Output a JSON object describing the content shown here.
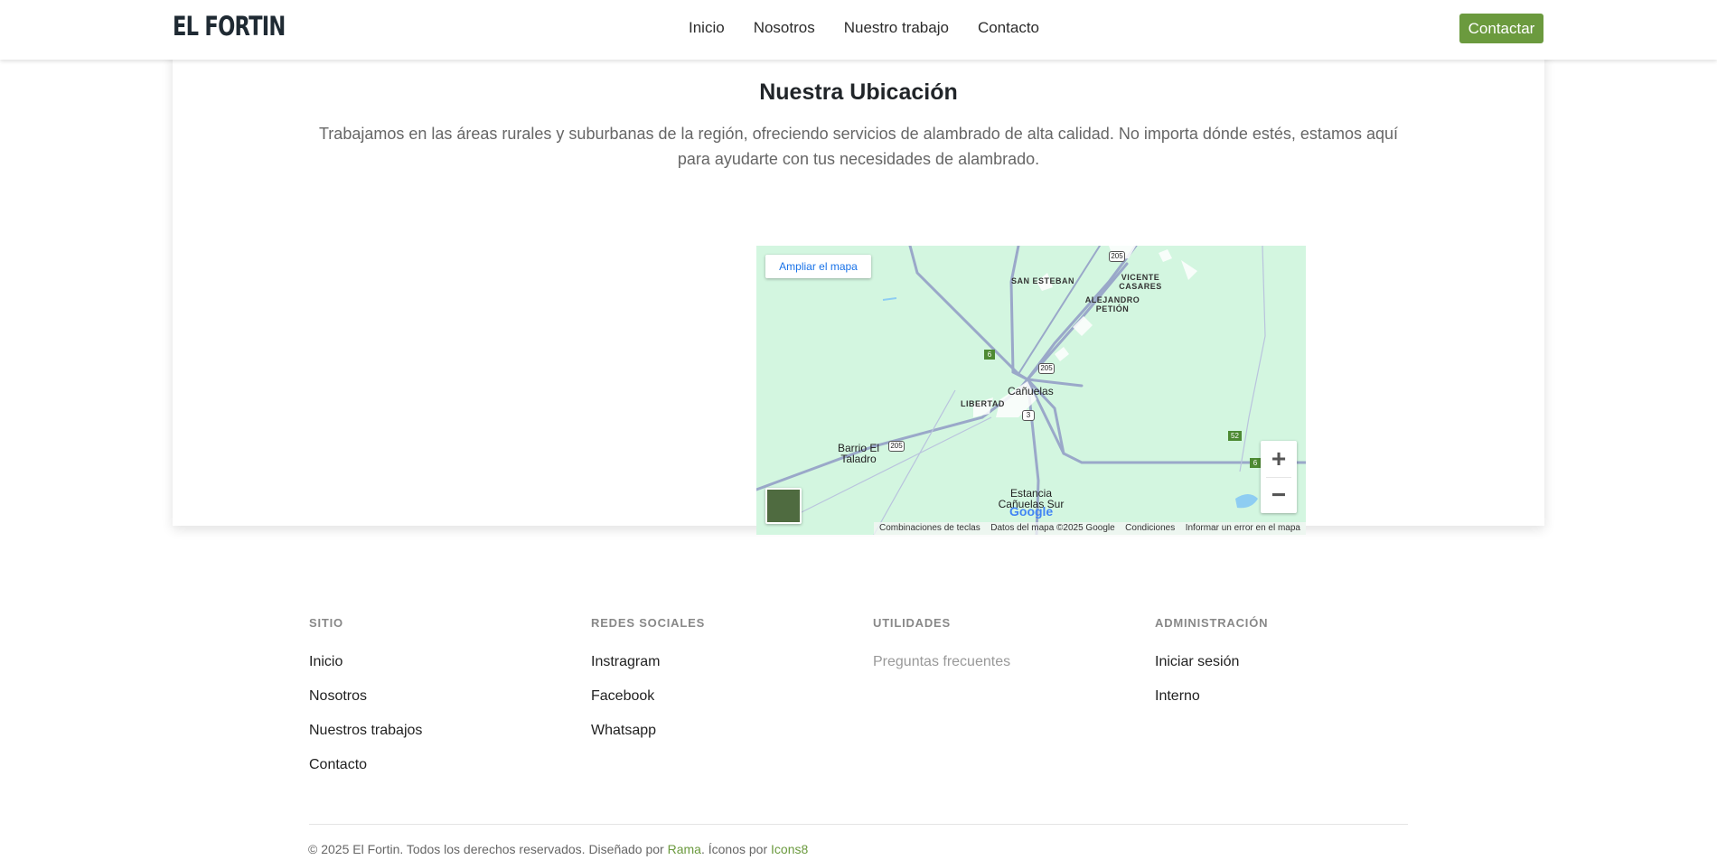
{
  "header": {
    "brand": "EL FORTIN",
    "nav": [
      "Inicio",
      "Nosotros",
      "Nuestro trabajo",
      "Contacto"
    ],
    "cta": "Contactar"
  },
  "location": {
    "title": "Nuestra Ubicación",
    "text": "Trabajamos en las áreas rurales y suburbanas de la región, ofreciendo servicios de alambrado de alta calidad. No importa dónde estés, estamos aquí para ayudarte con tus necesidades de alambrado."
  },
  "map": {
    "enlarge": "Ampliar el mapa",
    "labels": {
      "san_esteban": "SAN ESTEBAN",
      "vicente_casares": "VICENTE CASARES",
      "alejandro_petion": "ALEJANDRO PETIÓN",
      "libertad": "LIBERTAD",
      "canuelas": "Cañuelas",
      "barrio_el_taladro": "Barrio El Taladro",
      "estancia": "Estancia Cañuelas Sur"
    },
    "shields": {
      "r205a": "205",
      "r205b": "205",
      "r205c": "205",
      "r6a": "6",
      "r6b": "6",
      "r3": "3",
      "r52": "52"
    },
    "zoom_in": "+",
    "zoom_out": "−",
    "google": "Google",
    "attribution": {
      "shortcuts": "Combinaciones de teclas",
      "data": "Datos del mapa ©2025 Google",
      "terms": "Condiciones",
      "report": "Informar un error en el mapa"
    }
  },
  "footer": {
    "sitio": {
      "heading": "SITIO",
      "links": [
        "Inicio",
        "Nosotros",
        "Nuestros trabajos",
        "Contacto"
      ]
    },
    "redes": {
      "heading": "REDES SOCIALES",
      "links": [
        "Instragram",
        "Facebook",
        "Whatsapp"
      ]
    },
    "utilidades": {
      "heading": "UTILIDADES",
      "links": [
        "Preguntas frecuentes"
      ]
    },
    "admin": {
      "heading": "ADMINISTRACIÓN",
      "links": [
        "Iniciar sesión",
        "Interno"
      ]
    },
    "copyright_prefix": "© 2025 El Fortin. Todos los derechos reservados. Diseñado por ",
    "designer": "Rama",
    "icons_prefix": ". Íconos por ",
    "icons_by": "Icons8"
  },
  "colors": {
    "accent": "#6b9a3e",
    "map_background": "#d3f6e0",
    "road": "#9aa8c9"
  }
}
